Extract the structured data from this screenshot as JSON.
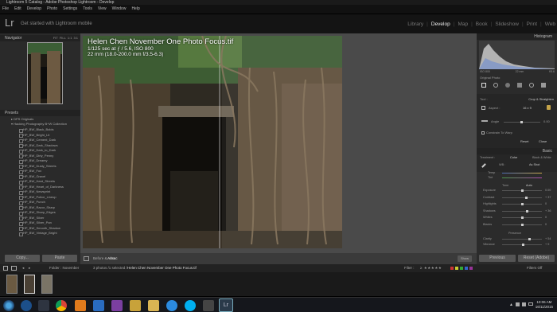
{
  "window": {
    "title": "Lightroom 5 Catalog - Adobe Photoshop Lightroom - Develop"
  },
  "menu": [
    "File",
    "Edit",
    "Develop",
    "Photo",
    "Settings",
    "Tools",
    "View",
    "Window",
    "Help"
  ],
  "identity": {
    "logo": "Lr",
    "tagline": "Get started with Lightroom mobile"
  },
  "modules": [
    "Library",
    "Develop",
    "Map",
    "Book",
    "Slideshow",
    "Print",
    "Web"
  ],
  "active_module": "Develop",
  "left": {
    "navigator": {
      "title": "Navigator",
      "zoom": [
        "FIT",
        "FILL",
        "1:1",
        "3:1"
      ]
    },
    "presets": {
      "title": "Presets",
      "groups": [
        "DPS Originals",
        "Hacking Photography B+W Collection"
      ],
      "items": [
        "HP_BW_Black_Bolds",
        "HP_BW_Bright_Lit",
        "HP_BW_Cement_Dark",
        "HP_BW_Dark_Shadows",
        "HP_BW_Dark_to_Dark",
        "HP_BW_Dirty_Penny",
        "HP_BW_Dreamy",
        "HP_BW_Dusty_Streets",
        "HP_BW_Fox",
        "HP_BW_Gravel",
        "HP_BW_Hard_Streets",
        "HP_BW_Heart_of_Darkness",
        "HP_BW_Newsprint",
        "HP_BW_Police_Lineup",
        "HP_BW_Punch",
        "HP_BW_Razor_Sharp",
        "HP_BW_Sharp_Edges",
        "HP_BW_Silver",
        "HP_BW_Silver_Pan",
        "HP_BW_Smooth_Shadow",
        "HP_BW_Vintage_Bright"
      ]
    },
    "copy": "Copy...",
    "paste": "Paste"
  },
  "photo_info": {
    "title": "Helen Chen November One Photo Focus.tif",
    "exposure": "1/125 sec at ƒ / 5.6, ISO 800",
    "lens": "22 mm (18.0-200.0 mm f/3.5-6.3)"
  },
  "toolbar": {
    "before_after": "Before & After :",
    "show": "Show",
    "value": "Ansac"
  },
  "right": {
    "histogram": {
      "title": "Histogram",
      "left_read": "ISO 800",
      "mid_read": "22 mm",
      "right_read": "f/5.6",
      "original": "Original Photo"
    },
    "crop": {
      "tool": "Tool :",
      "name": "Crop & Straighten",
      "aspect_label": "Aspect :",
      "aspect_value": "16 x 9",
      "angle_label": "Angle",
      "angle_value": "0.00",
      "constrain": "Constrain To Warp",
      "reset": "Reset",
      "close": "Close"
    },
    "basic": {
      "title": "Basic",
      "treatment": "Treatment :",
      "color": "Color",
      "bw": "Black & White",
      "wb_label": "WB :",
      "wb_value": "As Shot",
      "temp": "Temp",
      "tint": "Tint",
      "tone": "Tone",
      "auto": "Auto",
      "sliders": [
        {
          "label": "Exposure",
          "value": "0.00",
          "pos": 0.5
        },
        {
          "label": "Contrast",
          "value": "+ 37",
          "pos": 0.6
        },
        {
          "label": "Highlights",
          "value": "0",
          "pos": 0.5
        },
        {
          "label": "Shadows",
          "value": "+ 36",
          "pos": 0.62
        },
        {
          "label": "Whites",
          "value": "0",
          "pos": 0.5
        },
        {
          "label": "Blacks",
          "value": "0",
          "pos": 0.5
        }
      ],
      "presence": "Presence",
      "clarity": {
        "label": "Clarity",
        "value": "+ 54",
        "pos": 0.68
      },
      "vibrance": {
        "label": "Vibrance",
        "value": "+ 9",
        "pos": 0.53
      }
    },
    "previous": "Previous",
    "reset_adobe": "Reset (Adobe)"
  },
  "filmstrip": {
    "header": "Folder : November",
    "count": "3 photos /1 selected /",
    "file": "Helen Chen November One Photo Focus.tif",
    "filter": "Filter :",
    "filters_off": "Filters Off"
  },
  "taskbar": {
    "time": "10:06 AM",
    "date": "16/11/2015"
  }
}
